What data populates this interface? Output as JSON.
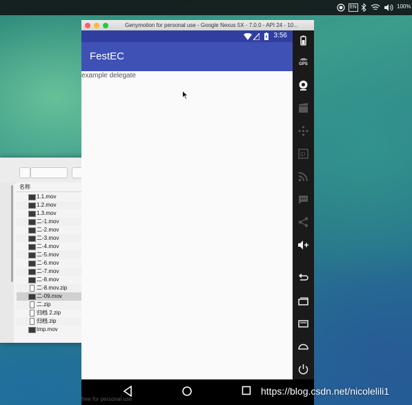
{
  "menubar": {
    "input_method": "EN",
    "battery": "100%"
  },
  "finder": {
    "column_header": "名称",
    "files": [
      {
        "name": "1.1.mov",
        "type": "mov"
      },
      {
        "name": "1.2.mov",
        "type": "mov"
      },
      {
        "name": "1.3.mov",
        "type": "mov"
      },
      {
        "name": "二-1.mov",
        "type": "mov"
      },
      {
        "name": "二-2.mov",
        "type": "mov"
      },
      {
        "name": "二-3.mov",
        "type": "mov"
      },
      {
        "name": "二-4.mov",
        "type": "mov"
      },
      {
        "name": "二-5.mov",
        "type": "mov"
      },
      {
        "name": "二-6.mov",
        "type": "mov"
      },
      {
        "name": "二-7.mov",
        "type": "mov"
      },
      {
        "name": "二-8.mov",
        "type": "mov"
      },
      {
        "name": "二-8.mov.zip",
        "type": "zip"
      },
      {
        "name": "二-09.mov",
        "type": "mov",
        "selected": true
      },
      {
        "name": "二.zip",
        "type": "zip"
      },
      {
        "name": "归档 2.zip",
        "type": "zip"
      },
      {
        "name": "归档.zip",
        "type": "zip"
      },
      {
        "name": "tmp.mov",
        "type": "mov"
      }
    ]
  },
  "genymotion": {
    "window_title": "Genymotion for personal use - Google Nexus 5X - 7.0.0 - API 24 - 10...",
    "footer_note": "free for personal use"
  },
  "phone": {
    "status_time": "3:56",
    "app_title": "FestEC",
    "content_text": "example delegate"
  },
  "sidebar_tools": [
    "battery-icon",
    "gps-icon",
    "webcam-icon",
    "clapboard-icon",
    "dpad-icon",
    "id-icon",
    "rss-icon",
    "sms-icon",
    "share-icon",
    "volume-up-icon",
    "back-icon",
    "recent-apps-icon",
    "menu-icon",
    "home-icon",
    "power-icon"
  ],
  "sidebar_labels": {
    "gps": "GPS"
  },
  "watermark": "https://blog.csdn.net/nicolelili1",
  "colors": {
    "app_bar": "#3f51b5",
    "status_bar": "#303f9f",
    "sidebar": "#1a1a1a"
  }
}
